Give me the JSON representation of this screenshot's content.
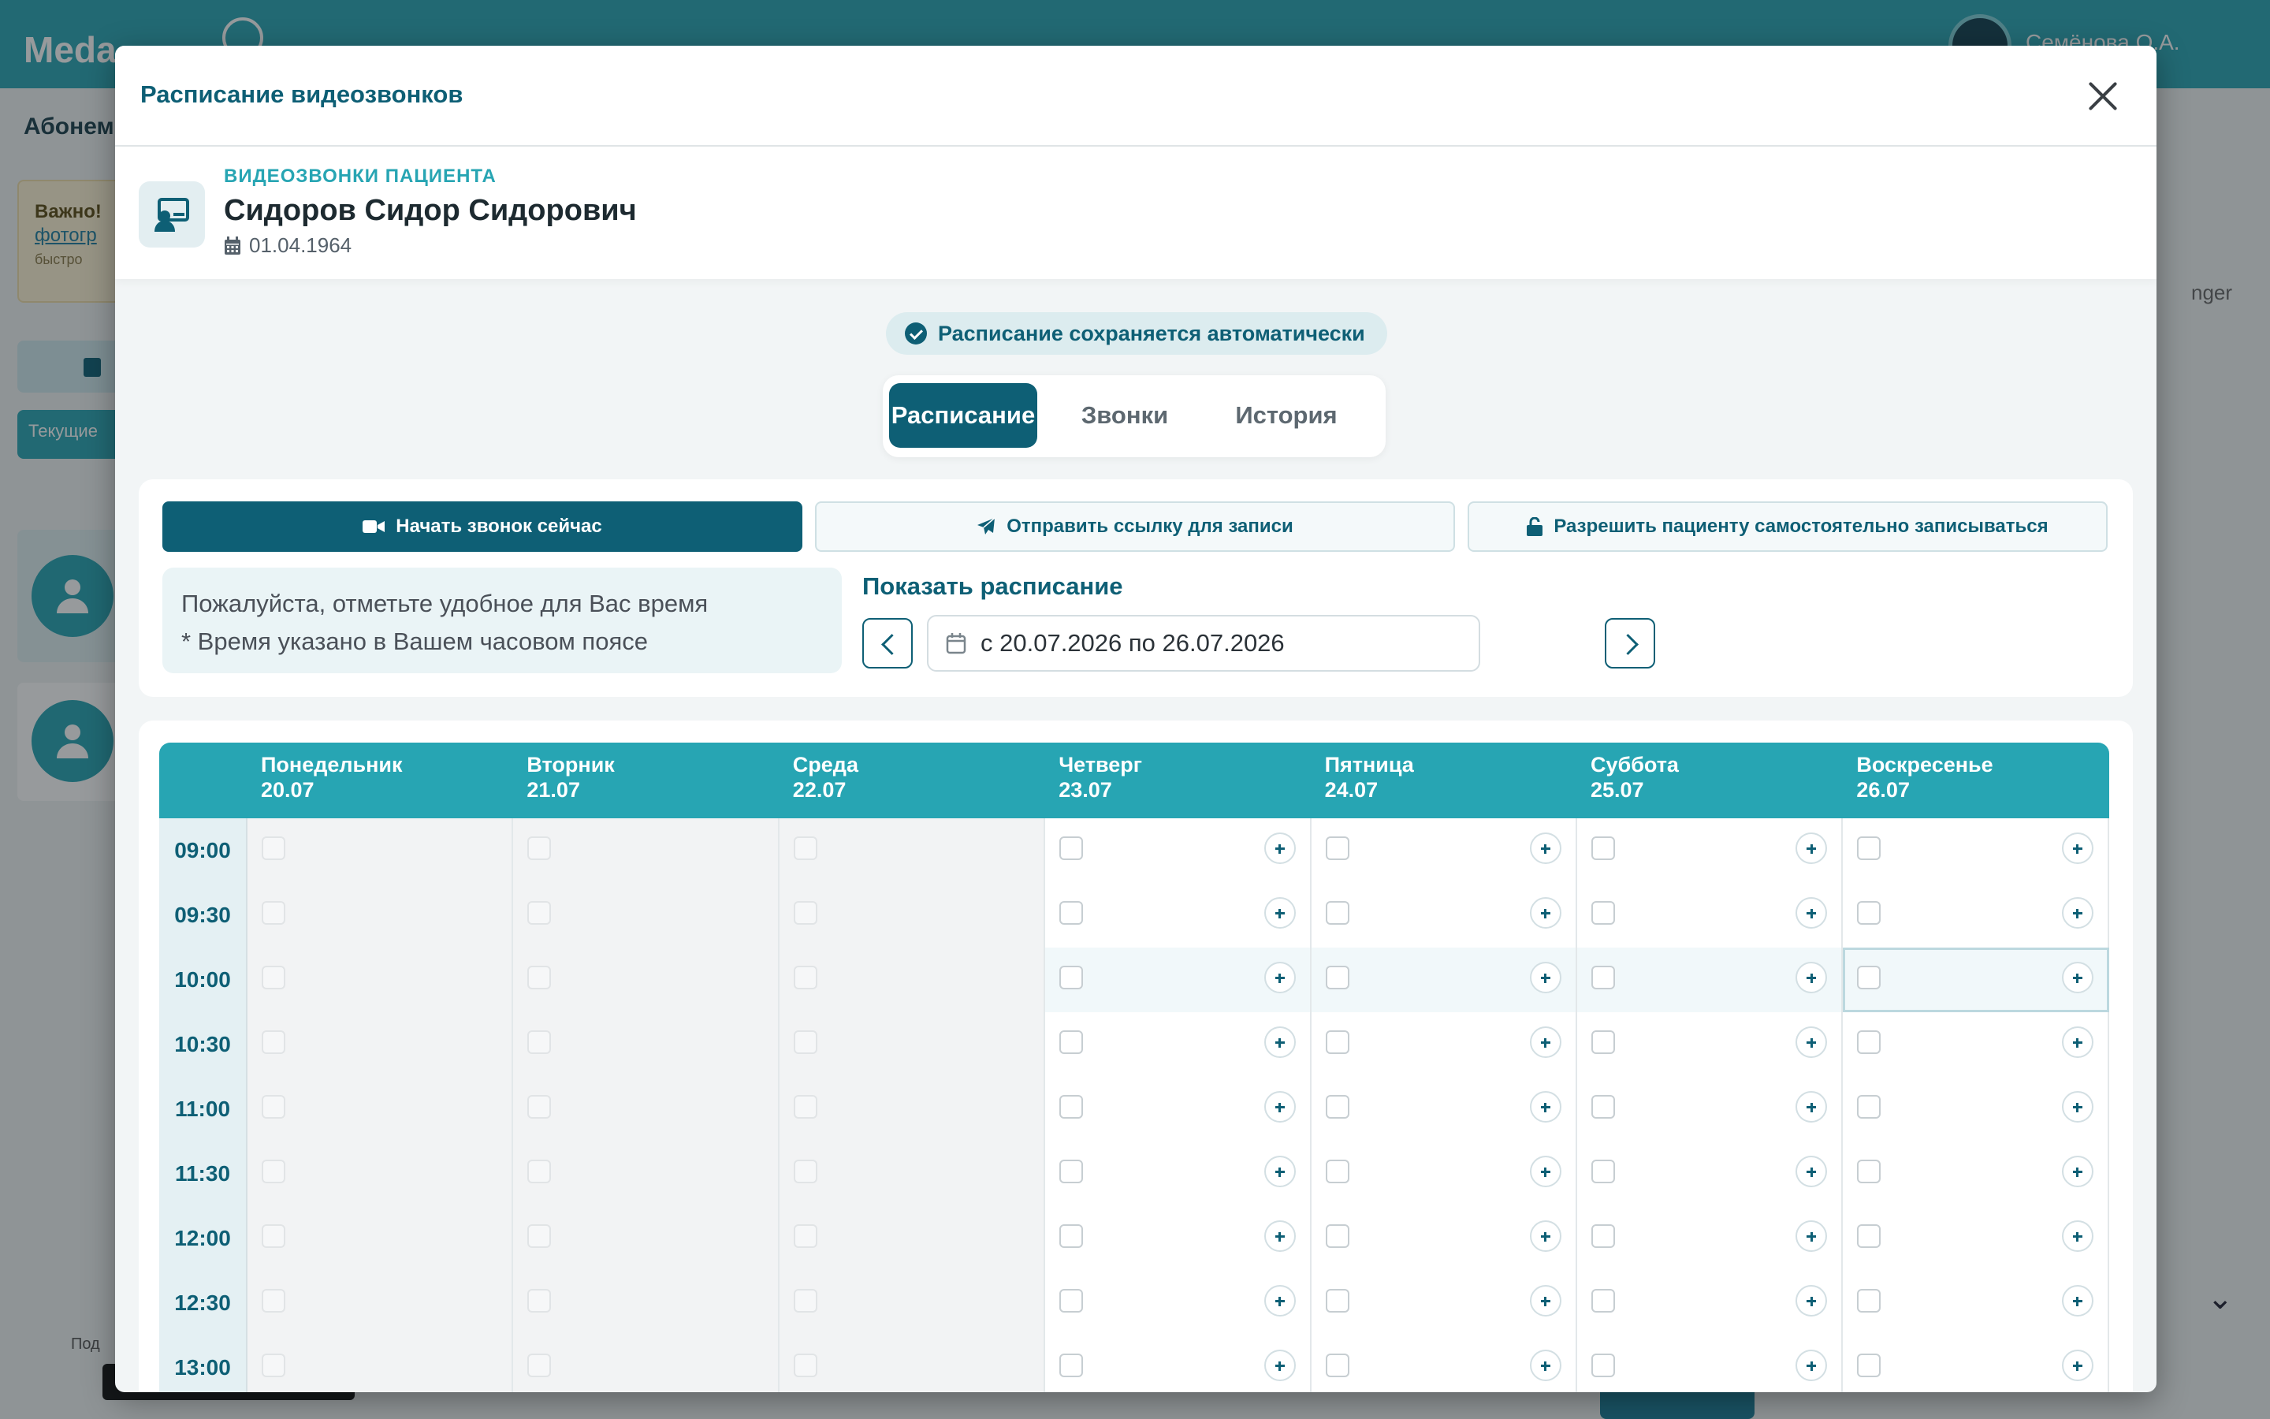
{
  "background": {
    "logo": "Medа",
    "user_name": "Семёнова О.А.",
    "nav_label": "Абонем",
    "notice_title": "Важно!",
    "notice_link": "фотогр",
    "notice_small": "быстро",
    "sidebar_button": "Текущие",
    "right_text": "nger",
    "footer_text": "Под"
  },
  "modal": {
    "title": "Расписание видеозвонков",
    "close_label": "Закрыть"
  },
  "patient": {
    "kicker": "ВИДЕОЗВОНКИ ПАЦИЕНТА",
    "name": "Сидоров Сидор Сидорович",
    "dob": "01.04.1964"
  },
  "autosave_text": "Расписание сохраняется автоматически",
  "tabs": [
    {
      "label": "Расписание",
      "active": true
    },
    {
      "label": "Звонки",
      "active": false
    },
    {
      "label": "История",
      "active": false
    }
  ],
  "actions": {
    "start_call": "Начать звонок сейчас",
    "send_link": "Отправить ссылку для записи",
    "allow_self_booking": "Разрешить пациенту самостоятельно записываться"
  },
  "hint": {
    "line1": "Пожалуйста, отметьте удобное для Вас время",
    "line2": "* Время указано в Вашем часовом поясе"
  },
  "show_schedule": {
    "label": "Показать расписание",
    "range": "с 20.07.2026 по 26.07.2026"
  },
  "days": [
    {
      "name": "Понедельник",
      "date": "20.07",
      "past": true
    },
    {
      "name": "Вторник",
      "date": "21.07",
      "past": true
    },
    {
      "name": "Среда",
      "date": "22.07",
      "past": true
    },
    {
      "name": "Четверг",
      "date": "23.07",
      "past": false
    },
    {
      "name": "Пятница",
      "date": "24.07",
      "past": false
    },
    {
      "name": "Суббота",
      "date": "25.07",
      "past": false
    },
    {
      "name": "Воскресенье",
      "date": "26.07",
      "past": false
    }
  ],
  "times": [
    "09:00",
    "09:30",
    "10:00",
    "10:30",
    "11:00",
    "11:30",
    "12:00",
    "12:30",
    "13:00"
  ],
  "highlighted_time": "10:00",
  "selected_cell": {
    "time": "10:00",
    "day": "Воскресенье"
  },
  "colors": {
    "primary": "#0e5f75",
    "accent": "#27a5b3",
    "hint_bg": "#eaf4f6"
  }
}
